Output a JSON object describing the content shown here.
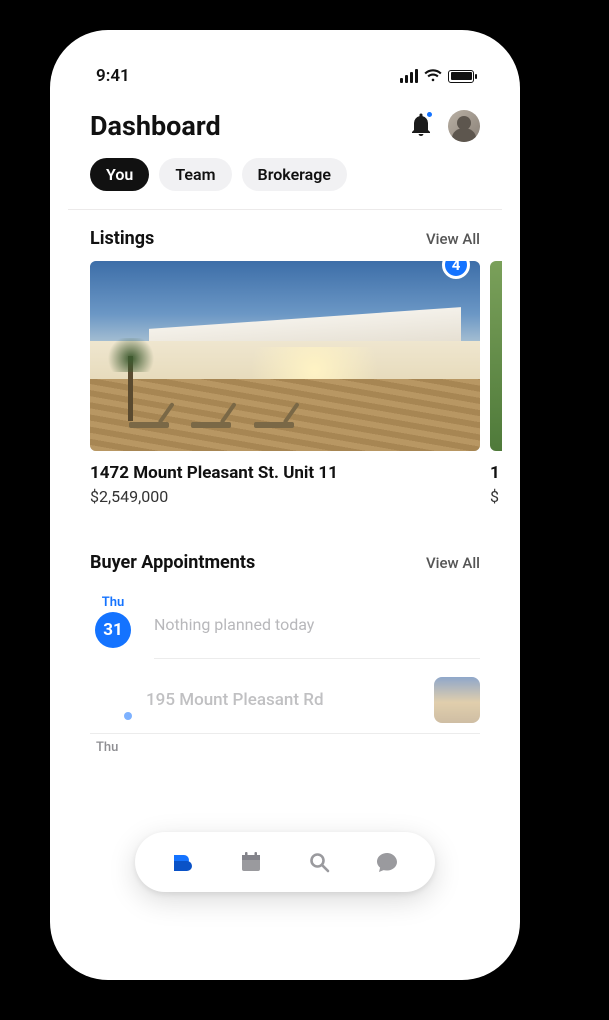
{
  "status": {
    "time": "9:41"
  },
  "header": {
    "title": "Dashboard",
    "notifications_unread": true
  },
  "tabs": [
    {
      "label": "You",
      "active": true
    },
    {
      "label": "Team",
      "active": false
    },
    {
      "label": "Brokerage",
      "active": false
    }
  ],
  "listings": {
    "title": "Listings",
    "view_all": "View All",
    "items": [
      {
        "address": "1472 Mount Pleasant St. Unit 11",
        "price": "$2,549,000",
        "badge": "4"
      },
      {
        "address": "1",
        "price": "$"
      }
    ]
  },
  "appointments": {
    "title": "Buyer Appointments",
    "view_all": "View All",
    "days": [
      {
        "dow": "Thu",
        "date": "31",
        "emptyText": "Nothing planned today",
        "items": [
          {
            "title": "195 Mount Pleasant Rd"
          }
        ]
      },
      {
        "dow": "Thu"
      }
    ]
  },
  "colors": {
    "accent": "#1473ff"
  }
}
